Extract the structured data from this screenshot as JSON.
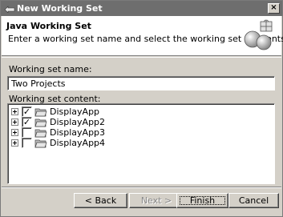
{
  "window": {
    "title": "New Working Set",
    "close_glyph": "×"
  },
  "header": {
    "title": "Java Working Set",
    "description": "Enter a working set name and select the working set elements."
  },
  "form": {
    "name_label": "Working set name:",
    "name_value": "Two Projects",
    "content_label": "Working set content:"
  },
  "tree": {
    "items": [
      {
        "label": "DisplayApp",
        "checked": true
      },
      {
        "label": "DisplayApp2",
        "checked": true
      },
      {
        "label": "DisplayApp3",
        "checked": false
      },
      {
        "label": "DisplayApp4",
        "checked": false
      }
    ]
  },
  "buttons": {
    "back": "< Back",
    "next": "Next >",
    "finish": "Finish",
    "cancel": "Cancel"
  },
  "icons": {
    "window": "java-window-icon",
    "wizard": "working-set-wizard-icon",
    "project": "project-folder-icon",
    "expand": "expand-plus-icon"
  }
}
